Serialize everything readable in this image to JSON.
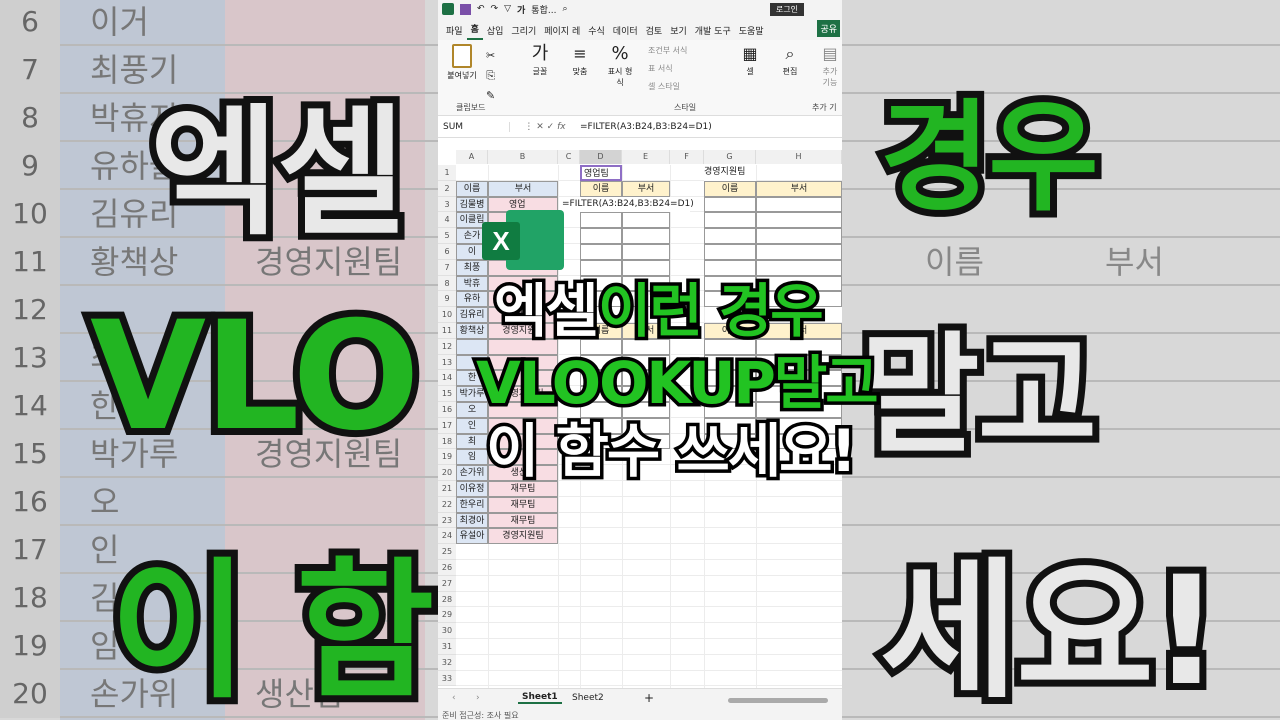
{
  "title_short": "통합...",
  "login_label": "로그인",
  "ribbon_tabs": [
    "파일",
    "홈",
    "삽입",
    "그리기",
    "페이지 레",
    "수식",
    "데이터",
    "검토",
    "보기",
    "개발 도구",
    "도움말"
  ],
  "share_label": "공유",
  "ribbon": {
    "paste": "붙여넣기",
    "clipboard": "클립보드",
    "font": "글꼴",
    "align": "맞춤",
    "number": "표시 형식",
    "cond": "조건부 서식",
    "table": "표 서식",
    "cellstyle": "셀 스타일",
    "style": "스타일",
    "cells": "셀",
    "edit": "편집",
    "addin": "추가 기능",
    "addin2": "추가 기"
  },
  "namebox": "SUM",
  "formula": "=FILTER(A3:B24,B3:B24=D1)",
  "cols": [
    "A",
    "B",
    "C",
    "D",
    "E",
    "F",
    "G",
    "H"
  ],
  "header_name": "이름",
  "header_dept": "부서",
  "d1": "영업팀",
  "g1": "경영지원팀",
  "b3_partial": "영업",
  "b3_formula": "=FILTER(A3:B24,B3:B24=D1)",
  "names": [
    "김물병",
    "이클립",
    "손가",
    "이",
    "최풍",
    "박휴",
    "유하",
    "김유리",
    "황책상",
    "",
    "",
    "한",
    "박가루",
    "오",
    "인",
    "최",
    "임",
    "손가위",
    "이유정",
    "한우리",
    "최경아",
    "유설아"
  ],
  "depts": [
    "",
    "",
    "",
    "",
    "",
    "",
    "",
    "경영",
    "경영지원팀",
    "",
    "",
    "",
    "경영지원팀",
    "",
    "",
    "",
    "",
    "생산팀",
    "재무팀",
    "재무팀",
    "재무팀",
    "경영지원팀"
  ],
  "sheets": [
    "Sheet1",
    "Sheet2"
  ],
  "status_text": "준비   접근성: 조사 필요",
  "overlay": {
    "line1a": "엑셀",
    "line1b": "이런 경우",
    "line2": "VLOOKUP말고",
    "line3": "이 함수 쓰세요!"
  },
  "bg": {
    "rows": [
      {
        "n": "6",
        "a": "이거"
      },
      {
        "n": "7",
        "a": "최풍기"
      },
      {
        "n": "8",
        "a": "박휴지"
      },
      {
        "n": "9",
        "a": "유하늘"
      },
      {
        "n": "10",
        "a": "김유리"
      },
      {
        "n": "11",
        "a": "황책상",
        "b": "경영지원팀",
        "c": "이름",
        "d": "부서"
      },
      {
        "n": "12",
        "a": ""
      },
      {
        "n": "13",
        "a": "최"
      },
      {
        "n": "14",
        "a": "한"
      },
      {
        "n": "15",
        "a": "박가루",
        "b": "경영지원팀"
      },
      {
        "n": "16",
        "a": "오"
      },
      {
        "n": "17",
        "a": "인"
      },
      {
        "n": "18",
        "a": "김"
      },
      {
        "n": "19",
        "a": "임"
      },
      {
        "n": "20",
        "a": "손가위",
        "b": "생산팀"
      }
    ],
    "big_left": [
      "엑셀",
      "VLO",
      "이 함"
    ],
    "big_right": [
      "경우",
      "말고",
      "세요!"
    ]
  },
  "colors": {
    "green": "#22c322",
    "excel": "#1d7044",
    "yellow": "#fff2cc",
    "blue": "#dce6f4",
    "pink": "#f8dde3"
  }
}
